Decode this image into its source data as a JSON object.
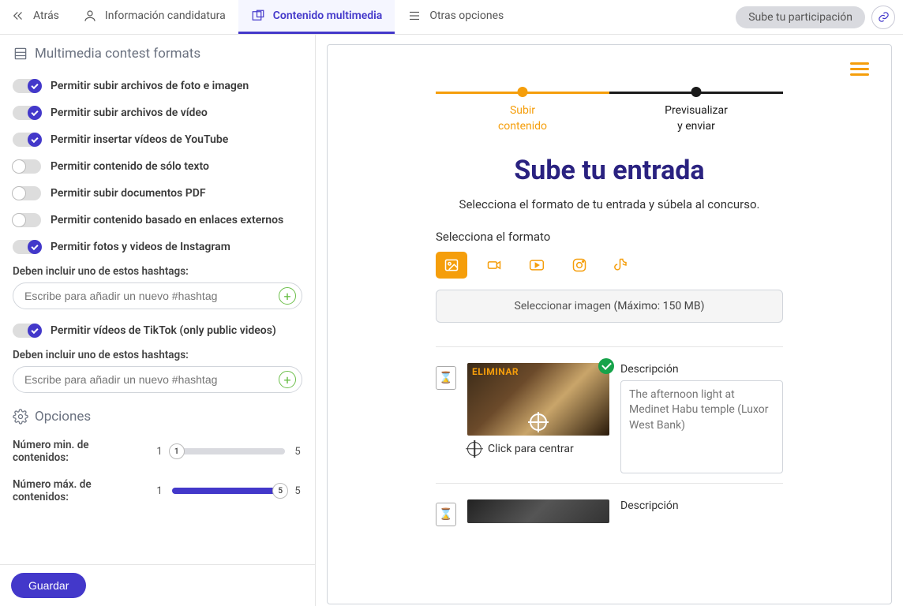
{
  "nav": {
    "back": "Atrás",
    "candidacy": "Información candidatura",
    "multimedia": "Contenido multimedia",
    "other": "Otras opciones",
    "upload_pill": "Sube tu participación"
  },
  "left": {
    "section_title": "Multimedia contest formats",
    "toggles": {
      "photo": "Permitir subir archivos de foto e imagen",
      "video": "Permitir subir archivos de vídeo",
      "youtube": "Permitir insertar vídeos de YouTube",
      "text_only": "Permitir contenido de sólo texto",
      "pdf": "Permitir subir documentos PDF",
      "external": "Permitir contenido basado en enlaces externos",
      "instagram": "Permitir fotos y videos de Instagram",
      "tiktok": "Permitir vídeos de TikTok (only public videos)"
    },
    "hashtag_label": "Deben incluir uno de estos hashtags:",
    "hashtag_placeholder": "Escribe para añadir un nuevo #hashtag",
    "options_title": "Opciones",
    "min_label": "Número min. de contenidos:",
    "max_label": "Número máx. de contenidos:",
    "slider_min_end": "1",
    "slider_max_end": "5",
    "min_value": "1",
    "max_value": "5",
    "save": "Guardar"
  },
  "preview": {
    "step1_l1": "Subir",
    "step1_l2": "contenido",
    "step2_l1": "Previsualizar",
    "step2_l2": "y enviar",
    "title": "Sube tu entrada",
    "subtitle": "Selecciona el formato de tu entrada y súbela al concurso.",
    "format_label": "Selecciona el formato",
    "select_image": "Seleccionar imagen",
    "max_note": "(Máximo: 150 MB)",
    "eliminate": "ELIMINAR",
    "click_center": "Click para centrar",
    "desc_label": "Descripción",
    "desc_placeholder": "The afternoon light at Medinet Habu temple (Luxor West Bank)"
  }
}
